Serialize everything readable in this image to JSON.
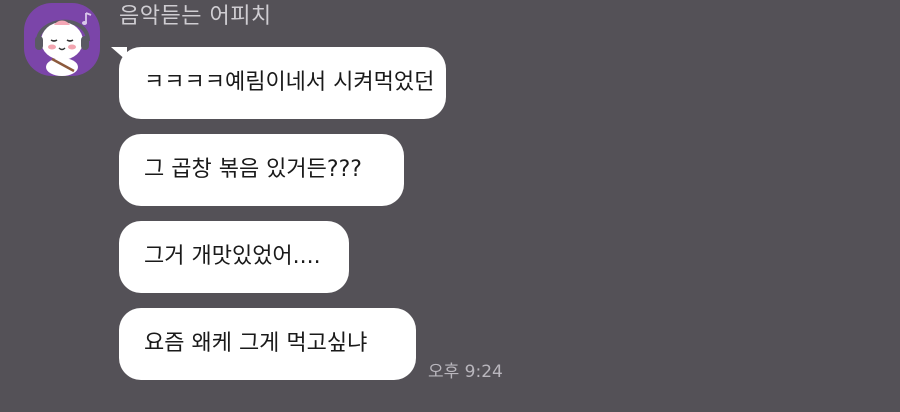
{
  "sender": {
    "name": "음악듣는 어피치",
    "avatar_icon": "apeach-with-headphones-icon"
  },
  "messages": [
    {
      "text": "ㅋㅋㅋㅋ예림이네서 시켜먹었던"
    },
    {
      "text": "그 곱창 볶음 있거든???"
    },
    {
      "text": "그거 개맛있었어...."
    },
    {
      "text": "요즘 왜케 그게 먹고싶냐"
    }
  ],
  "timestamp": "오후 9:24",
  "colors": {
    "background": "#545157",
    "bubble": "#ffffff",
    "avatar_bg": "#7b45a9"
  }
}
